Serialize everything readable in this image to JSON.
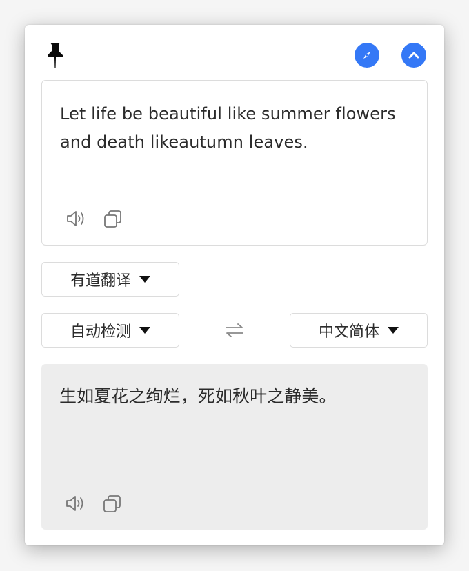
{
  "colors": {
    "accent": "#3478f6",
    "result_bg": "#ededed",
    "text": "#2b2b2b",
    "border": "#dcdcdc"
  },
  "toolbar": {
    "pin_icon": "pin-icon",
    "compass_icon": "compass-icon",
    "collapse_icon": "chevron-up-icon"
  },
  "source": {
    "text": "Let life be beautiful like summer flowers and death likeautumn leaves.",
    "speak_icon": "speaker-icon",
    "copy_icon": "copy-icon"
  },
  "engine": {
    "selected": "有道翻译"
  },
  "languages": {
    "from": "自动检测",
    "to": "中文简体",
    "swap_icon": "swap-arrows-icon"
  },
  "result": {
    "text": "生如夏花之绚烂，死如秋叶之静美。",
    "speak_icon": "speaker-icon",
    "copy_icon": "copy-icon"
  }
}
